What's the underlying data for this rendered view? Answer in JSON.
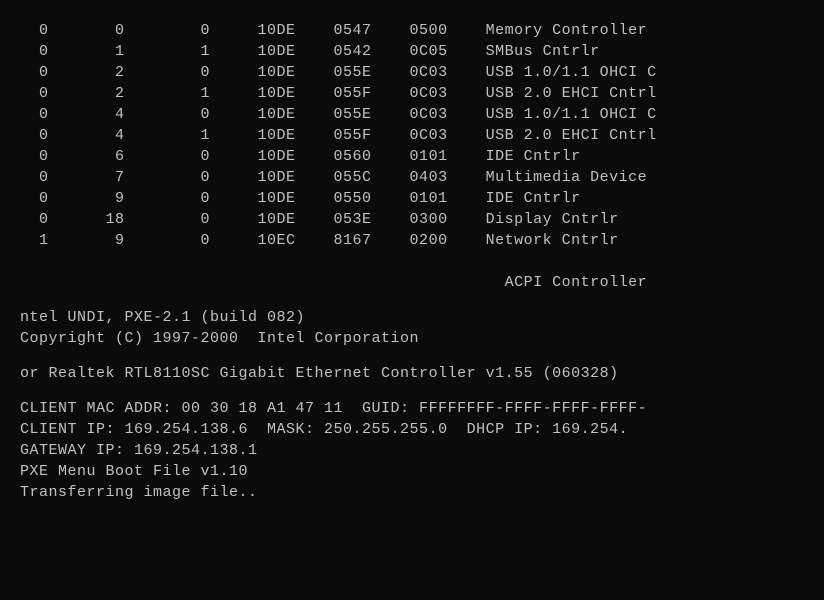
{
  "pci": [
    {
      "bus": "0",
      "dev": "0",
      "fn": "0",
      "vend": "10DE",
      "devid": "0547",
      "class": "0500",
      "name": "Memory Controller"
    },
    {
      "bus": "0",
      "dev": "1",
      "fn": "1",
      "vend": "10DE",
      "devid": "0542",
      "class": "0C05",
      "name": "SMBus Cntrlr"
    },
    {
      "bus": "0",
      "dev": "2",
      "fn": "0",
      "vend": "10DE",
      "devid": "055E",
      "class": "0C03",
      "name": "USB 1.0/1.1 OHCI C"
    },
    {
      "bus": "0",
      "dev": "2",
      "fn": "1",
      "vend": "10DE",
      "devid": "055F",
      "class": "0C03",
      "name": "USB 2.0 EHCI Cntrl"
    },
    {
      "bus": "0",
      "dev": "4",
      "fn": "0",
      "vend": "10DE",
      "devid": "055E",
      "class": "0C03",
      "name": "USB 1.0/1.1 OHCI C"
    },
    {
      "bus": "0",
      "dev": "4",
      "fn": "1",
      "vend": "10DE",
      "devid": "055F",
      "class": "0C03",
      "name": "USB 2.0 EHCI Cntrl"
    },
    {
      "bus": "0",
      "dev": "6",
      "fn": "0",
      "vend": "10DE",
      "devid": "0560",
      "class": "0101",
      "name": "IDE Cntrlr"
    },
    {
      "bus": "0",
      "dev": "7",
      "fn": "0",
      "vend": "10DE",
      "devid": "055C",
      "class": "0403",
      "name": "Multimedia Device"
    },
    {
      "bus": "0",
      "dev": "9",
      "fn": "0",
      "vend": "10DE",
      "devid": "0550",
      "class": "0101",
      "name": "IDE Cntrlr"
    },
    {
      "bus": "0",
      "dev": "18",
      "fn": "0",
      "vend": "10DE",
      "devid": "053E",
      "class": "0300",
      "name": "Display Cntrlr"
    },
    {
      "bus": "1",
      "dev": "9",
      "fn": "0",
      "vend": "10EC",
      "devid": "8167",
      "class": "0200",
      "name": "Network Cntrlr"
    }
  ],
  "extra_device": "ACPI Controller",
  "status": {
    "line1": "ntel UNDI, PXE-2.1 (build 082)",
    "line2": "Copyright (C) 1997-2000  Intel Corporation",
    "line3": "or Realtek RTL8110SC Gigabit Ethernet Controller v1.55 (060328)",
    "line4": "CLIENT MAC ADDR: 00 30 18 A1 47 11  GUID: FFFFFFFF-FFFF-FFFF-FFFF-",
    "line5": "CLIENT IP: 169.254.138.6  MASK: 250.255.255.0  DHCP IP: 169.254.",
    "line6": "GATEWAY IP: 169.254.138.1",
    "line7": "PXE Menu Boot File v1.10",
    "line8": "Transferring image file.."
  }
}
